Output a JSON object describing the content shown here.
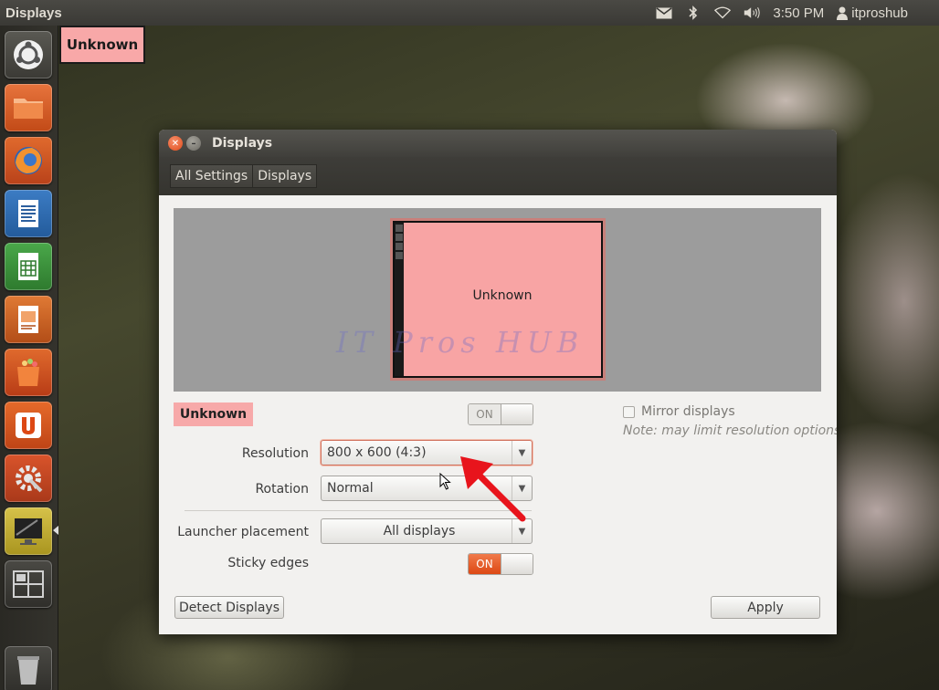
{
  "top_panel": {
    "app_title": "Displays",
    "time": "3:50 PM",
    "user": "itproshub",
    "icons": [
      "mail-icon",
      "bluetooth-icon",
      "wifi-icon",
      "volume-icon",
      "user-icon"
    ]
  },
  "launcher": {
    "items": [
      "ubuntu-dash",
      "files",
      "firefox",
      "libreoffice-writer",
      "libreoffice-calc",
      "libreoffice-impress",
      "ubuntu-software-center",
      "ubuntu-one",
      "system-settings",
      "displays",
      "workspace-switcher",
      "trash"
    ]
  },
  "corner_label": "Unknown",
  "window": {
    "title": "Displays",
    "breadcrumbs": [
      "All Settings",
      "Displays"
    ],
    "monitor_label": "Unknown",
    "watermark": "IT Pros HUB",
    "display_tag": "Unknown",
    "monitor_switch": "ON",
    "monitor_switch_state": "off",
    "mirror_label": "Mirror displays",
    "mirror_note": "Note: may limit resolution options",
    "resolution_label": "Resolution",
    "resolution_value": "800 x 600 (4:3)",
    "rotation_label": "Rotation",
    "rotation_value": "Normal",
    "launcher_label": "Launcher placement",
    "launcher_value": "All displays",
    "sticky_label": "Sticky edges",
    "sticky_switch": "ON",
    "sticky_switch_state": "on",
    "detect_button": "Detect Displays",
    "apply_button": "Apply"
  },
  "colors": {
    "accent_orange": "#dd4814",
    "monitor_pink": "#f8a4a4",
    "annotation_red": "#e8141c"
  }
}
